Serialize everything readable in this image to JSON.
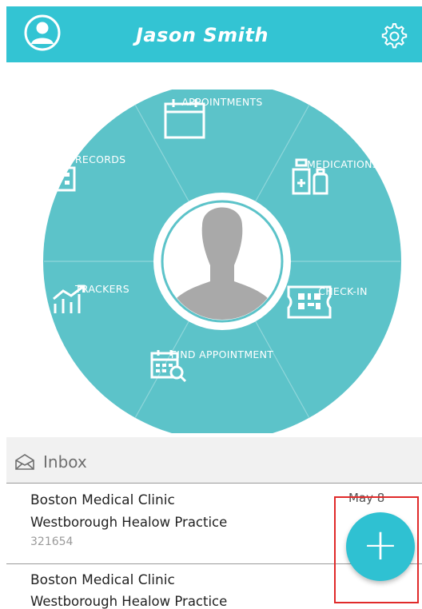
{
  "header": {
    "user_name": "Jason Smith",
    "avatar_icon": "user-avatar-icon",
    "settings_icon": "gear-icon",
    "bg_color": "#33c4d3"
  },
  "wheel": {
    "color": "#5cc3c9",
    "segments": [
      {
        "label": "APPOINTMENTS",
        "icon": "calendar-icon"
      },
      {
        "label": "MEDICATIONS",
        "icon": "medication-bottles-icon"
      },
      {
        "label": "CHECK-IN",
        "icon": "qr-code-icon"
      },
      {
        "label": "FIND APPOINTMENT",
        "icon": "calendar-search-icon"
      },
      {
        "label": "TRACKERS",
        "icon": "chart-trend-icon"
      },
      {
        "label": "MY RECORDS",
        "icon": "hospital-icon"
      }
    ],
    "center_icon": "profile-silhouette"
  },
  "inbox": {
    "label": "Inbox",
    "messages": [
      {
        "title": "Boston Medical Clinic",
        "subtitle": "Westborough Healow Practice",
        "id": "321654",
        "date": "May 8"
      },
      {
        "title": "Boston Medical Clinic",
        "subtitle": "Westborough Healow Practice"
      }
    ]
  },
  "fab": {
    "symbol": "+",
    "color": "#2fc1d2"
  }
}
